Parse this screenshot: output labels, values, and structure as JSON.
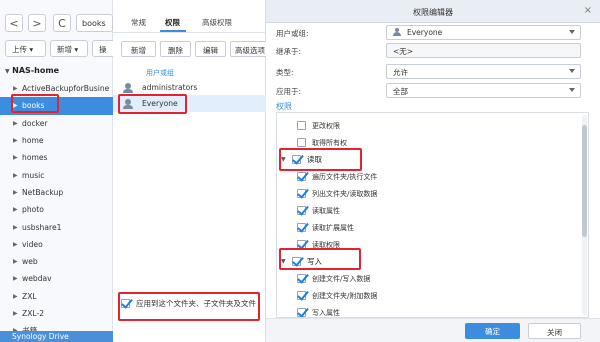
{
  "left": {
    "nav_back": "<",
    "nav_forward": ">",
    "refresh": "C",
    "path": "books",
    "upload": "上传 ▾",
    "create": "新增 ▾",
    "more": "操",
    "root": "NAS-home",
    "folders": [
      "ActiveBackupforBusine",
      "books",
      "docker",
      "home",
      "homes",
      "music",
      "NetBackup",
      "photo",
      "usbshare1",
      "video",
      "web",
      "webdav",
      "ZXL",
      "ZXL-2",
      "书籍"
    ],
    "selected_folder": "books",
    "footer": "Synology Drive"
  },
  "middle": {
    "tabs": [
      "常规",
      "权限",
      "高级权限"
    ],
    "active_tab": "权限",
    "buttons": [
      "新增",
      "删除",
      "编辑",
      "高级选项"
    ],
    "column_header": "用户或组",
    "users": [
      "administrators",
      "Everyone"
    ],
    "selected_user": "Everyone",
    "apply_label": "应用到这个文件夹、子文件夹及文件",
    "apply_checked": true
  },
  "right": {
    "title": "权限编辑器",
    "close": "×",
    "fields": [
      {
        "label": "用户或组:",
        "value": "Everyone",
        "icon": "user-icon"
      },
      {
        "label": "继承于:",
        "value": "<无>"
      },
      {
        "label": "类型:",
        "value": "允许"
      },
      {
        "label": "应用于:",
        "value": "全部"
      }
    ],
    "section": "权限",
    "permissions": [
      {
        "label": "更改权限",
        "checked": false,
        "group": false
      },
      {
        "label": "取得所有权",
        "checked": false,
        "group": false
      },
      {
        "label": "读取",
        "checked": true,
        "group": true
      },
      {
        "label": "遍历文件夹/执行文件",
        "checked": true,
        "group": false
      },
      {
        "label": "列出文件夹/读取数据",
        "checked": true,
        "group": false
      },
      {
        "label": "读取属性",
        "checked": true,
        "group": false
      },
      {
        "label": "读取扩展属性",
        "checked": true,
        "group": false
      },
      {
        "label": "读取权限",
        "checked": true,
        "group": false
      },
      {
        "label": "写入",
        "checked": true,
        "group": true
      },
      {
        "label": "创建文件/写入数据",
        "checked": true,
        "group": false
      },
      {
        "label": "创建文件夹/附加数据",
        "checked": true,
        "group": false
      },
      {
        "label": "写入属性",
        "checked": true,
        "group": false
      }
    ],
    "ok": "确定",
    "close_button": "关闭"
  },
  "colors": {
    "accent": "#3c8de0",
    "highlight_box": "#e3232f",
    "selection": "#3c8de0"
  }
}
